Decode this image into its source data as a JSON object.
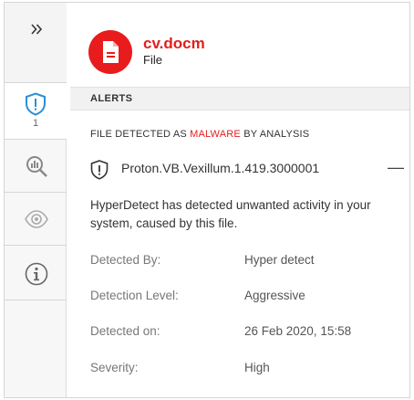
{
  "file": {
    "name": "cv.docm",
    "type": "File"
  },
  "rail": {
    "expand_icon": "double-chevron-right-icon",
    "items": [
      {
        "icon": "shield-alert-icon",
        "count": "1"
      },
      {
        "icon": "search-analysis-icon"
      },
      {
        "icon": "eye-icon"
      },
      {
        "icon": "info-icon"
      }
    ]
  },
  "alerts": {
    "section_title": "ALERTS",
    "detected_prefix": "FILE DETECTED AS ",
    "detected_verdict": "MALWARE",
    "detected_suffix": " BY ANALYSIS",
    "threat_name": "Proton.VB.Vexillum.1.419.3000001",
    "collapse_symbol": "—",
    "description": "HyperDetect has detected unwanted activity in your system, caused by this file.",
    "details": [
      {
        "label": "Detected By:",
        "value": "Hyper detect"
      },
      {
        "label": "Detection Level:",
        "value": "Aggressive"
      },
      {
        "label": "Detected on:",
        "value": "26 Feb 2020, 15:58"
      },
      {
        "label": "Severity:",
        "value": "High"
      }
    ]
  },
  "colors": {
    "accent_red": "#e81c1c",
    "shield_blue": "#2d8fd5"
  }
}
